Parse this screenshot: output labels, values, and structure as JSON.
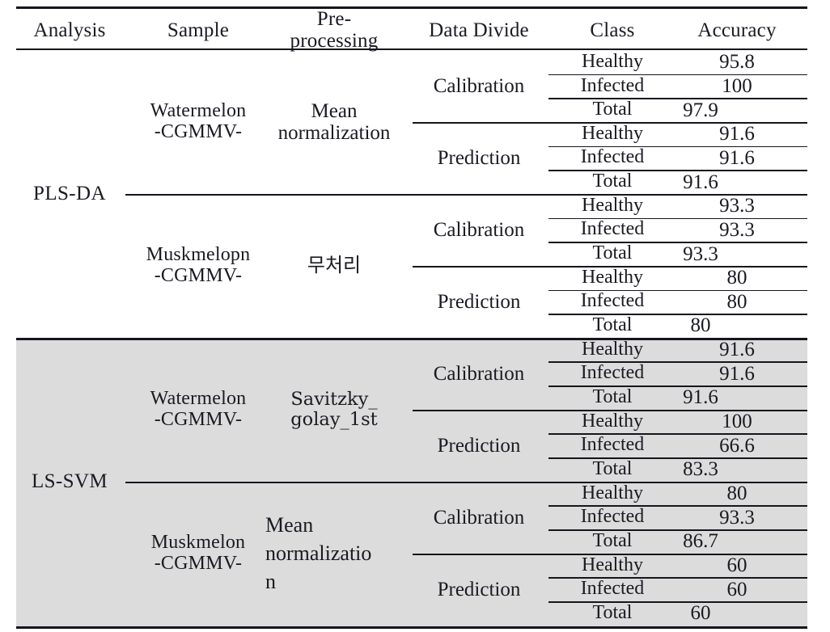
{
  "table": {
    "columns": [
      {
        "key": "analysis",
        "label": "Analysis"
      },
      {
        "key": "sample",
        "label": "Sample"
      },
      {
        "key": "preprocessing",
        "label": "Pre-\nprocessing"
      },
      {
        "key": "data_divide",
        "label": "Data Divide"
      },
      {
        "key": "class",
        "label": "Class"
      },
      {
        "key": "accuracy",
        "label": "Accuracy"
      }
    ],
    "shaded_row_color": "#dcdcdc",
    "rule_color": "#15151c",
    "groups": [
      {
        "analysis": "PLS-DA",
        "shaded": false,
        "samples": [
          {
            "sample": "Watermelon\n-CGMMV-",
            "preprocessing": "Mean\nnormalization",
            "preprocessing_style": "default",
            "divides": [
              {
                "data_divide": "Calibration",
                "rows": [
                  {
                    "class": "Healthy",
                    "accuracy": "95.8"
                  },
                  {
                    "class": "Infected",
                    "accuracy": "100"
                  },
                  {
                    "class": "Total",
                    "accuracy": "97.9"
                  }
                ]
              },
              {
                "data_divide": "Prediction",
                "rows": [
                  {
                    "class": "Healthy",
                    "accuracy": "91.6"
                  },
                  {
                    "class": "Infected",
                    "accuracy": "91.6"
                  },
                  {
                    "class": "Total",
                    "accuracy": "91.6"
                  }
                ]
              }
            ]
          },
          {
            "sample": "Muskmelopn\n-CGMMV-",
            "preprocessing": "무처리",
            "preprocessing_style": "korean",
            "divides": [
              {
                "data_divide": "Calibration",
                "rows": [
                  {
                    "class": "Healthy",
                    "accuracy": "93.3"
                  },
                  {
                    "class": "Infected",
                    "accuracy": "93.3"
                  },
                  {
                    "class": "Total",
                    "accuracy": "93.3"
                  }
                ]
              },
              {
                "data_divide": "Prediction",
                "rows": [
                  {
                    "class": "Healthy",
                    "accuracy": "80"
                  },
                  {
                    "class": "Infected",
                    "accuracy": "80"
                  },
                  {
                    "class": "Total",
                    "accuracy": "80"
                  }
                ]
              }
            ]
          }
        ]
      },
      {
        "analysis": "LS-SVM",
        "shaded": true,
        "samples": [
          {
            "sample": "Watermelon\n-CGMMV-",
            "preprocessing": "Savitzky_\ngolay_1st",
            "preprocessing_style": "alt",
            "divides": [
              {
                "data_divide": "Calibration",
                "rows": [
                  {
                    "class": "Healthy",
                    "accuracy": "91.6"
                  },
                  {
                    "class": "Infected",
                    "accuracy": "91.6"
                  },
                  {
                    "class": "Total",
                    "accuracy": "91.6"
                  }
                ]
              },
              {
                "data_divide": "Prediction",
                "rows": [
                  {
                    "class": "Healthy",
                    "accuracy": "100"
                  },
                  {
                    "class": "Infected",
                    "accuracy": "66.6"
                  },
                  {
                    "class": "Total",
                    "accuracy": "83.3"
                  }
                ]
              }
            ]
          },
          {
            "sample": "Muskmelon\n-CGMMV-",
            "preprocessing": "Mean\nnormalizatio\nn",
            "preprocessing_style": "left",
            "divides": [
              {
                "data_divide": "Calibration",
                "rows": [
                  {
                    "class": "Healthy",
                    "accuracy": "80"
                  },
                  {
                    "class": "Infected",
                    "accuracy": "93.3"
                  },
                  {
                    "class": "Total",
                    "accuracy": "86.7"
                  }
                ]
              },
              {
                "data_divide": "Prediction",
                "rows": [
                  {
                    "class": "Healthy",
                    "accuracy": "60"
                  },
                  {
                    "class": "Infected",
                    "accuracy": "60"
                  },
                  {
                    "class": "Total",
                    "accuracy": "60"
                  }
                ]
              }
            ]
          }
        ]
      }
    ]
  }
}
